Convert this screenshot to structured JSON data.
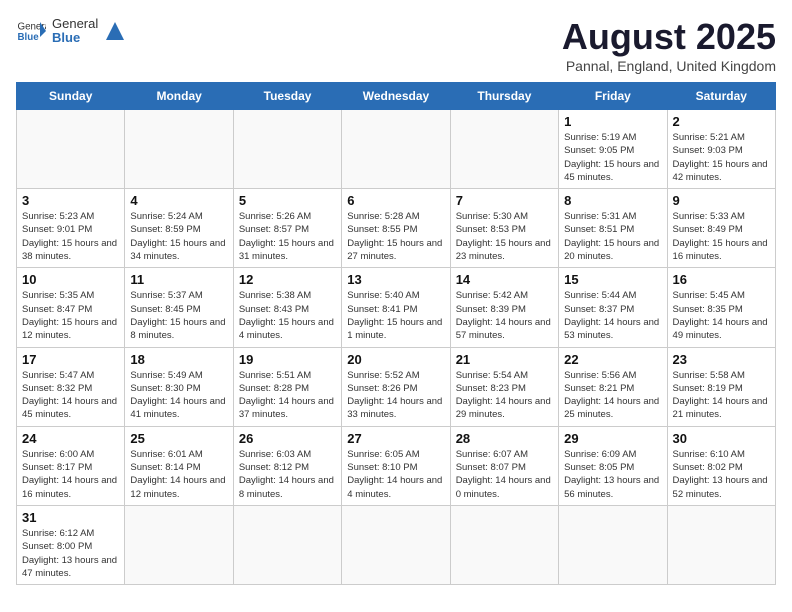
{
  "header": {
    "logo_text_normal": "General",
    "logo_text_bold": "Blue",
    "title": "August 2025",
    "subtitle": "Pannal, England, United Kingdom"
  },
  "weekdays": [
    "Sunday",
    "Monday",
    "Tuesday",
    "Wednesday",
    "Thursday",
    "Friday",
    "Saturday"
  ],
  "weeks": [
    [
      {
        "day": "",
        "info": ""
      },
      {
        "day": "",
        "info": ""
      },
      {
        "day": "",
        "info": ""
      },
      {
        "day": "",
        "info": ""
      },
      {
        "day": "",
        "info": ""
      },
      {
        "day": "1",
        "info": "Sunrise: 5:19 AM\nSunset: 9:05 PM\nDaylight: 15 hours and 45 minutes."
      },
      {
        "day": "2",
        "info": "Sunrise: 5:21 AM\nSunset: 9:03 PM\nDaylight: 15 hours and 42 minutes."
      }
    ],
    [
      {
        "day": "3",
        "info": "Sunrise: 5:23 AM\nSunset: 9:01 PM\nDaylight: 15 hours and 38 minutes."
      },
      {
        "day": "4",
        "info": "Sunrise: 5:24 AM\nSunset: 8:59 PM\nDaylight: 15 hours and 34 minutes."
      },
      {
        "day": "5",
        "info": "Sunrise: 5:26 AM\nSunset: 8:57 PM\nDaylight: 15 hours and 31 minutes."
      },
      {
        "day": "6",
        "info": "Sunrise: 5:28 AM\nSunset: 8:55 PM\nDaylight: 15 hours and 27 minutes."
      },
      {
        "day": "7",
        "info": "Sunrise: 5:30 AM\nSunset: 8:53 PM\nDaylight: 15 hours and 23 minutes."
      },
      {
        "day": "8",
        "info": "Sunrise: 5:31 AM\nSunset: 8:51 PM\nDaylight: 15 hours and 20 minutes."
      },
      {
        "day": "9",
        "info": "Sunrise: 5:33 AM\nSunset: 8:49 PM\nDaylight: 15 hours and 16 minutes."
      }
    ],
    [
      {
        "day": "10",
        "info": "Sunrise: 5:35 AM\nSunset: 8:47 PM\nDaylight: 15 hours and 12 minutes."
      },
      {
        "day": "11",
        "info": "Sunrise: 5:37 AM\nSunset: 8:45 PM\nDaylight: 15 hours and 8 minutes."
      },
      {
        "day": "12",
        "info": "Sunrise: 5:38 AM\nSunset: 8:43 PM\nDaylight: 15 hours and 4 minutes."
      },
      {
        "day": "13",
        "info": "Sunrise: 5:40 AM\nSunset: 8:41 PM\nDaylight: 15 hours and 1 minute."
      },
      {
        "day": "14",
        "info": "Sunrise: 5:42 AM\nSunset: 8:39 PM\nDaylight: 14 hours and 57 minutes."
      },
      {
        "day": "15",
        "info": "Sunrise: 5:44 AM\nSunset: 8:37 PM\nDaylight: 14 hours and 53 minutes."
      },
      {
        "day": "16",
        "info": "Sunrise: 5:45 AM\nSunset: 8:35 PM\nDaylight: 14 hours and 49 minutes."
      }
    ],
    [
      {
        "day": "17",
        "info": "Sunrise: 5:47 AM\nSunset: 8:32 PM\nDaylight: 14 hours and 45 minutes."
      },
      {
        "day": "18",
        "info": "Sunrise: 5:49 AM\nSunset: 8:30 PM\nDaylight: 14 hours and 41 minutes."
      },
      {
        "day": "19",
        "info": "Sunrise: 5:51 AM\nSunset: 8:28 PM\nDaylight: 14 hours and 37 minutes."
      },
      {
        "day": "20",
        "info": "Sunrise: 5:52 AM\nSunset: 8:26 PM\nDaylight: 14 hours and 33 minutes."
      },
      {
        "day": "21",
        "info": "Sunrise: 5:54 AM\nSunset: 8:23 PM\nDaylight: 14 hours and 29 minutes."
      },
      {
        "day": "22",
        "info": "Sunrise: 5:56 AM\nSunset: 8:21 PM\nDaylight: 14 hours and 25 minutes."
      },
      {
        "day": "23",
        "info": "Sunrise: 5:58 AM\nSunset: 8:19 PM\nDaylight: 14 hours and 21 minutes."
      }
    ],
    [
      {
        "day": "24",
        "info": "Sunrise: 6:00 AM\nSunset: 8:17 PM\nDaylight: 14 hours and 16 minutes."
      },
      {
        "day": "25",
        "info": "Sunrise: 6:01 AM\nSunset: 8:14 PM\nDaylight: 14 hours and 12 minutes."
      },
      {
        "day": "26",
        "info": "Sunrise: 6:03 AM\nSunset: 8:12 PM\nDaylight: 14 hours and 8 minutes."
      },
      {
        "day": "27",
        "info": "Sunrise: 6:05 AM\nSunset: 8:10 PM\nDaylight: 14 hours and 4 minutes."
      },
      {
        "day": "28",
        "info": "Sunrise: 6:07 AM\nSunset: 8:07 PM\nDaylight: 14 hours and 0 minutes."
      },
      {
        "day": "29",
        "info": "Sunrise: 6:09 AM\nSunset: 8:05 PM\nDaylight: 13 hours and 56 minutes."
      },
      {
        "day": "30",
        "info": "Sunrise: 6:10 AM\nSunset: 8:02 PM\nDaylight: 13 hours and 52 minutes."
      }
    ],
    [
      {
        "day": "31",
        "info": "Sunrise: 6:12 AM\nSunset: 8:00 PM\nDaylight: 13 hours and 47 minutes."
      },
      {
        "day": "",
        "info": ""
      },
      {
        "day": "",
        "info": ""
      },
      {
        "day": "",
        "info": ""
      },
      {
        "day": "",
        "info": ""
      },
      {
        "day": "",
        "info": ""
      },
      {
        "day": "",
        "info": ""
      }
    ]
  ]
}
